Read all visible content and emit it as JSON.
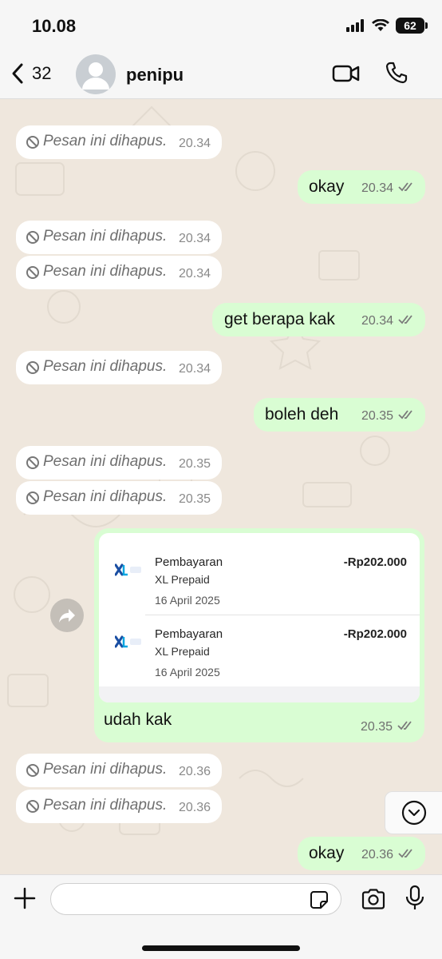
{
  "status_bar": {
    "time": "10.08",
    "battery": "62"
  },
  "header": {
    "back_count": "32",
    "contact_name": "penipu"
  },
  "messages": [
    {
      "text": "Pesan ini dihapus.",
      "time": "20.34"
    },
    {
      "text": "okay",
      "time": "20.34"
    },
    {
      "text": "Pesan ini dihapus.",
      "time": "20.34"
    },
    {
      "text": "Pesan ini dihapus.",
      "time": "20.34"
    },
    {
      "text": "get berapa kak",
      "time": "20.34"
    },
    {
      "text": "Pesan ini dihapus.",
      "time": "20.34"
    },
    {
      "text": "boleh deh",
      "time": "20.35"
    },
    {
      "text": "Pesan ini dihapus.",
      "time": "20.35"
    },
    {
      "text": "Pesan ini dihapus.",
      "time": "20.35"
    },
    {
      "text": "udah kak",
      "time": "20.35"
    },
    {
      "text": "Pesan ini dihapus.",
      "time": "20.36"
    },
    {
      "text": "Pesan ini dihapus.",
      "time": "20.36"
    },
    {
      "text": "okay",
      "time": "20.36"
    }
  ],
  "receipt": {
    "transactions": [
      {
        "title": "Pembayaran",
        "subtitle": "XL Prepaid",
        "date": "16 April 2025",
        "amount": "-Rp202.000"
      },
      {
        "title": "Pembayaran",
        "subtitle": "XL Prepaid",
        "date": "16 April 2025",
        "amount": "-Rp202.000"
      }
    ]
  },
  "composer": {
    "value": ""
  },
  "icons": [
    "back-chevron-icon",
    "avatar-icon",
    "video-call-icon",
    "phone-icon",
    "deleted-icon",
    "double-check-icon",
    "xl-logo-icon",
    "forward-icon",
    "chevron-down-icon",
    "plus-icon",
    "sticker-icon",
    "camera-icon",
    "mic-icon"
  ]
}
